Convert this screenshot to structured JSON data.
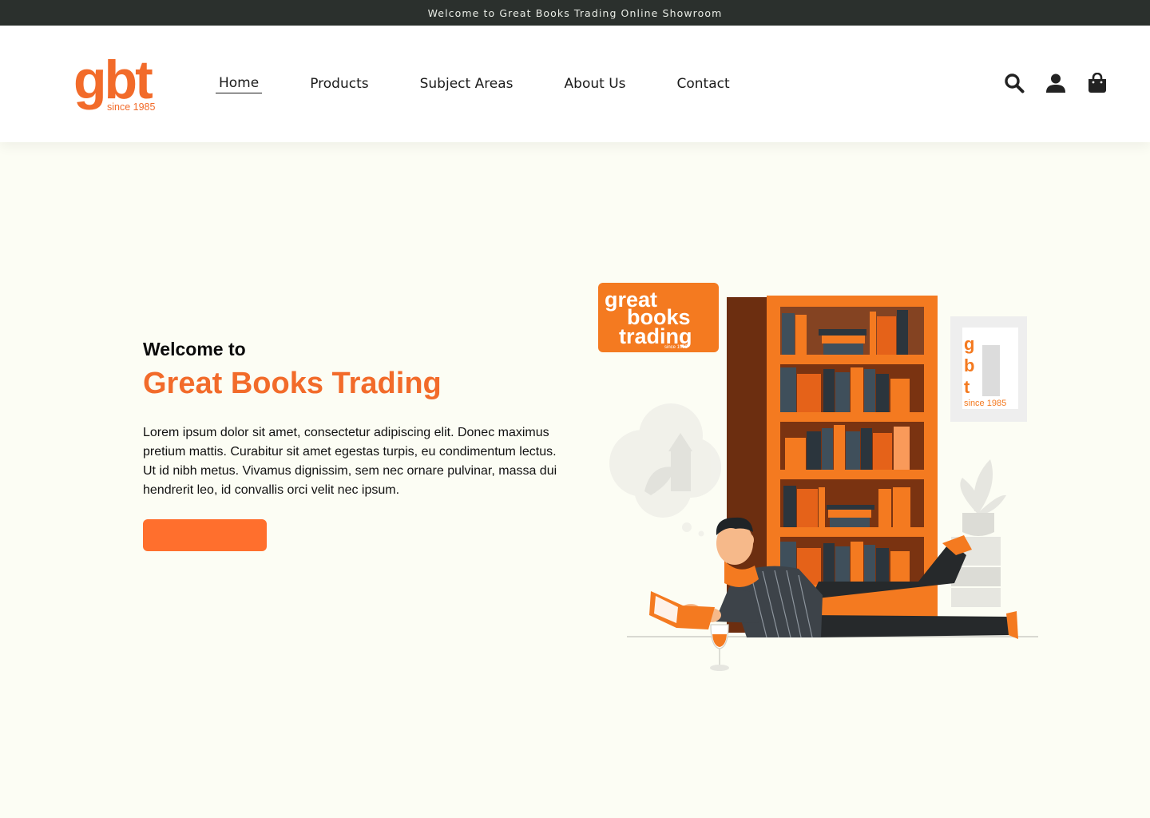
{
  "topbar": {
    "text": "Welcome to Great Books Trading Online Showroom"
  },
  "logo": {
    "main": "gbt",
    "sub": "since 1985"
  },
  "nav": {
    "items": [
      "Home",
      "Products",
      "Subject Areas",
      "About Us",
      "Contact"
    ],
    "active": "Home"
  },
  "header_icons": [
    "search-icon",
    "user-icon",
    "shopping-bag-icon"
  ],
  "hero": {
    "welcome": "Welcome to",
    "title": "Great Books Trading",
    "body": "Lorem ipsum dolor sit amet, consectetur adipiscing elit. Donec maximus pretium mattis. Curabitur sit amet egestas turpis, eu condimentum lectus. Ut id nibh metus. Vivamus dignissim, sem nec ornare pulvinar, massa dui hendrerit leo, id convallis orci velit nec ipsum.",
    "cta_label": ""
  },
  "illustration": {
    "sign_line1": "great",
    "sign_line2": "books",
    "sign_line3": "trading",
    "sign_since": "since 1985",
    "frame_letters": [
      "g",
      "b",
      "t"
    ],
    "frame_since": "since 1985"
  },
  "colors": {
    "accent": "#f26b2a",
    "dark": "#2b302d",
    "background": "#fcfdf4"
  }
}
